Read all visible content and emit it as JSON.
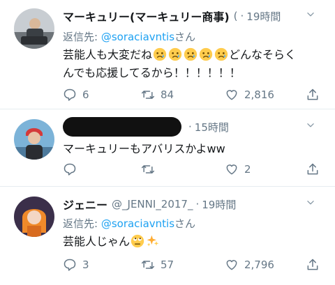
{
  "tweets": [
    {
      "name": "マーキュリー(マーキュリー商事)",
      "handle": "(",
      "time": "19時間",
      "reply_prefix": "返信先: ",
      "reply_mention": "@soraciavntis",
      "reply_suffix": "さん",
      "text_before": "芸能人も大変だね",
      "text_after": "どんなそらく\nんでも応援してるから！！！！！！",
      "emojis": [
        "crying-face",
        "crying-face",
        "crying-face",
        "crying-face",
        "crying-face"
      ],
      "replies": "6",
      "retweets": "84",
      "likes": "2,816"
    },
    {
      "name": "",
      "handle": "",
      "time": "15時間",
      "text": "マーキュリーもアバリスかよww",
      "replies": "",
      "retweets": "",
      "likes": "2"
    },
    {
      "name": "ジェニー",
      "handle": "@_JENNI_2017_",
      "time": "19時間",
      "reply_prefix": "返信先: ",
      "reply_mention": "@soraciavntis",
      "reply_suffix": "さん",
      "text": "芸能人じゃん",
      "emojis": [
        "rolling-eyes-face",
        "sparkles"
      ],
      "replies": "3",
      "retweets": "57",
      "likes": "2,796"
    }
  ],
  "colors": {
    "accent": "#1da1f2",
    "muted": "#657786",
    "divider": "#e6ecf0"
  }
}
